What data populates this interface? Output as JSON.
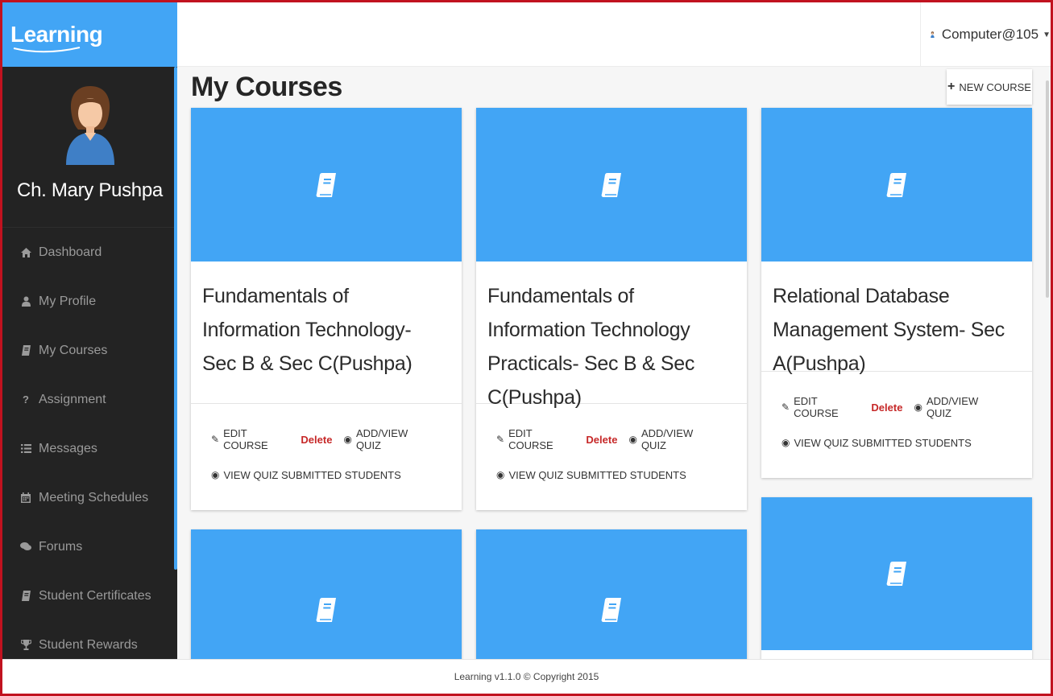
{
  "app": {
    "brand": "Learning"
  },
  "header": {
    "user_label": "Computer@105"
  },
  "sidebar": {
    "profile_name": "Ch. Mary Pushpa",
    "items": [
      {
        "label": "Dashboard",
        "icon": "home-icon"
      },
      {
        "label": "My Profile",
        "icon": "user-icon"
      },
      {
        "label": "My Courses",
        "icon": "book-icon"
      },
      {
        "label": "Assignment",
        "icon": "question-icon"
      },
      {
        "label": "Messages",
        "icon": "list-icon"
      },
      {
        "label": "Meeting Schedules",
        "icon": "calendar-icon"
      },
      {
        "label": "Forums",
        "icon": "chat-icon"
      },
      {
        "label": "Student Certificates",
        "icon": "book-icon"
      },
      {
        "label": "Student Rewards",
        "icon": "trophy-icon"
      }
    ]
  },
  "main": {
    "title": "My Courses",
    "new_course_label": "NEW COURSE",
    "actions": {
      "edit": "EDIT COURSE",
      "delete": "Delete",
      "quiz": "ADD/VIEW QUIZ",
      "submitted": "VIEW QUIZ SUBMITTED STUDENTS"
    },
    "courses": [
      {
        "title": "Fundamentals of Information Technology- Sec B & Sec C(Pushpa)"
      },
      {
        "title": "Fundamentals of Information Technology Practicals- Sec B & Sec C(Pushpa)"
      },
      {
        "title": "Relational Database Management System- Sec A(Pushpa)"
      }
    ]
  },
  "footer": {
    "text": "Learning v1.1.0 © Copyright 2015"
  },
  "colors": {
    "accent": "#42a5f5",
    "sidebar_bg": "#232323",
    "delete": "#c62828",
    "frame": "#c1121f"
  }
}
